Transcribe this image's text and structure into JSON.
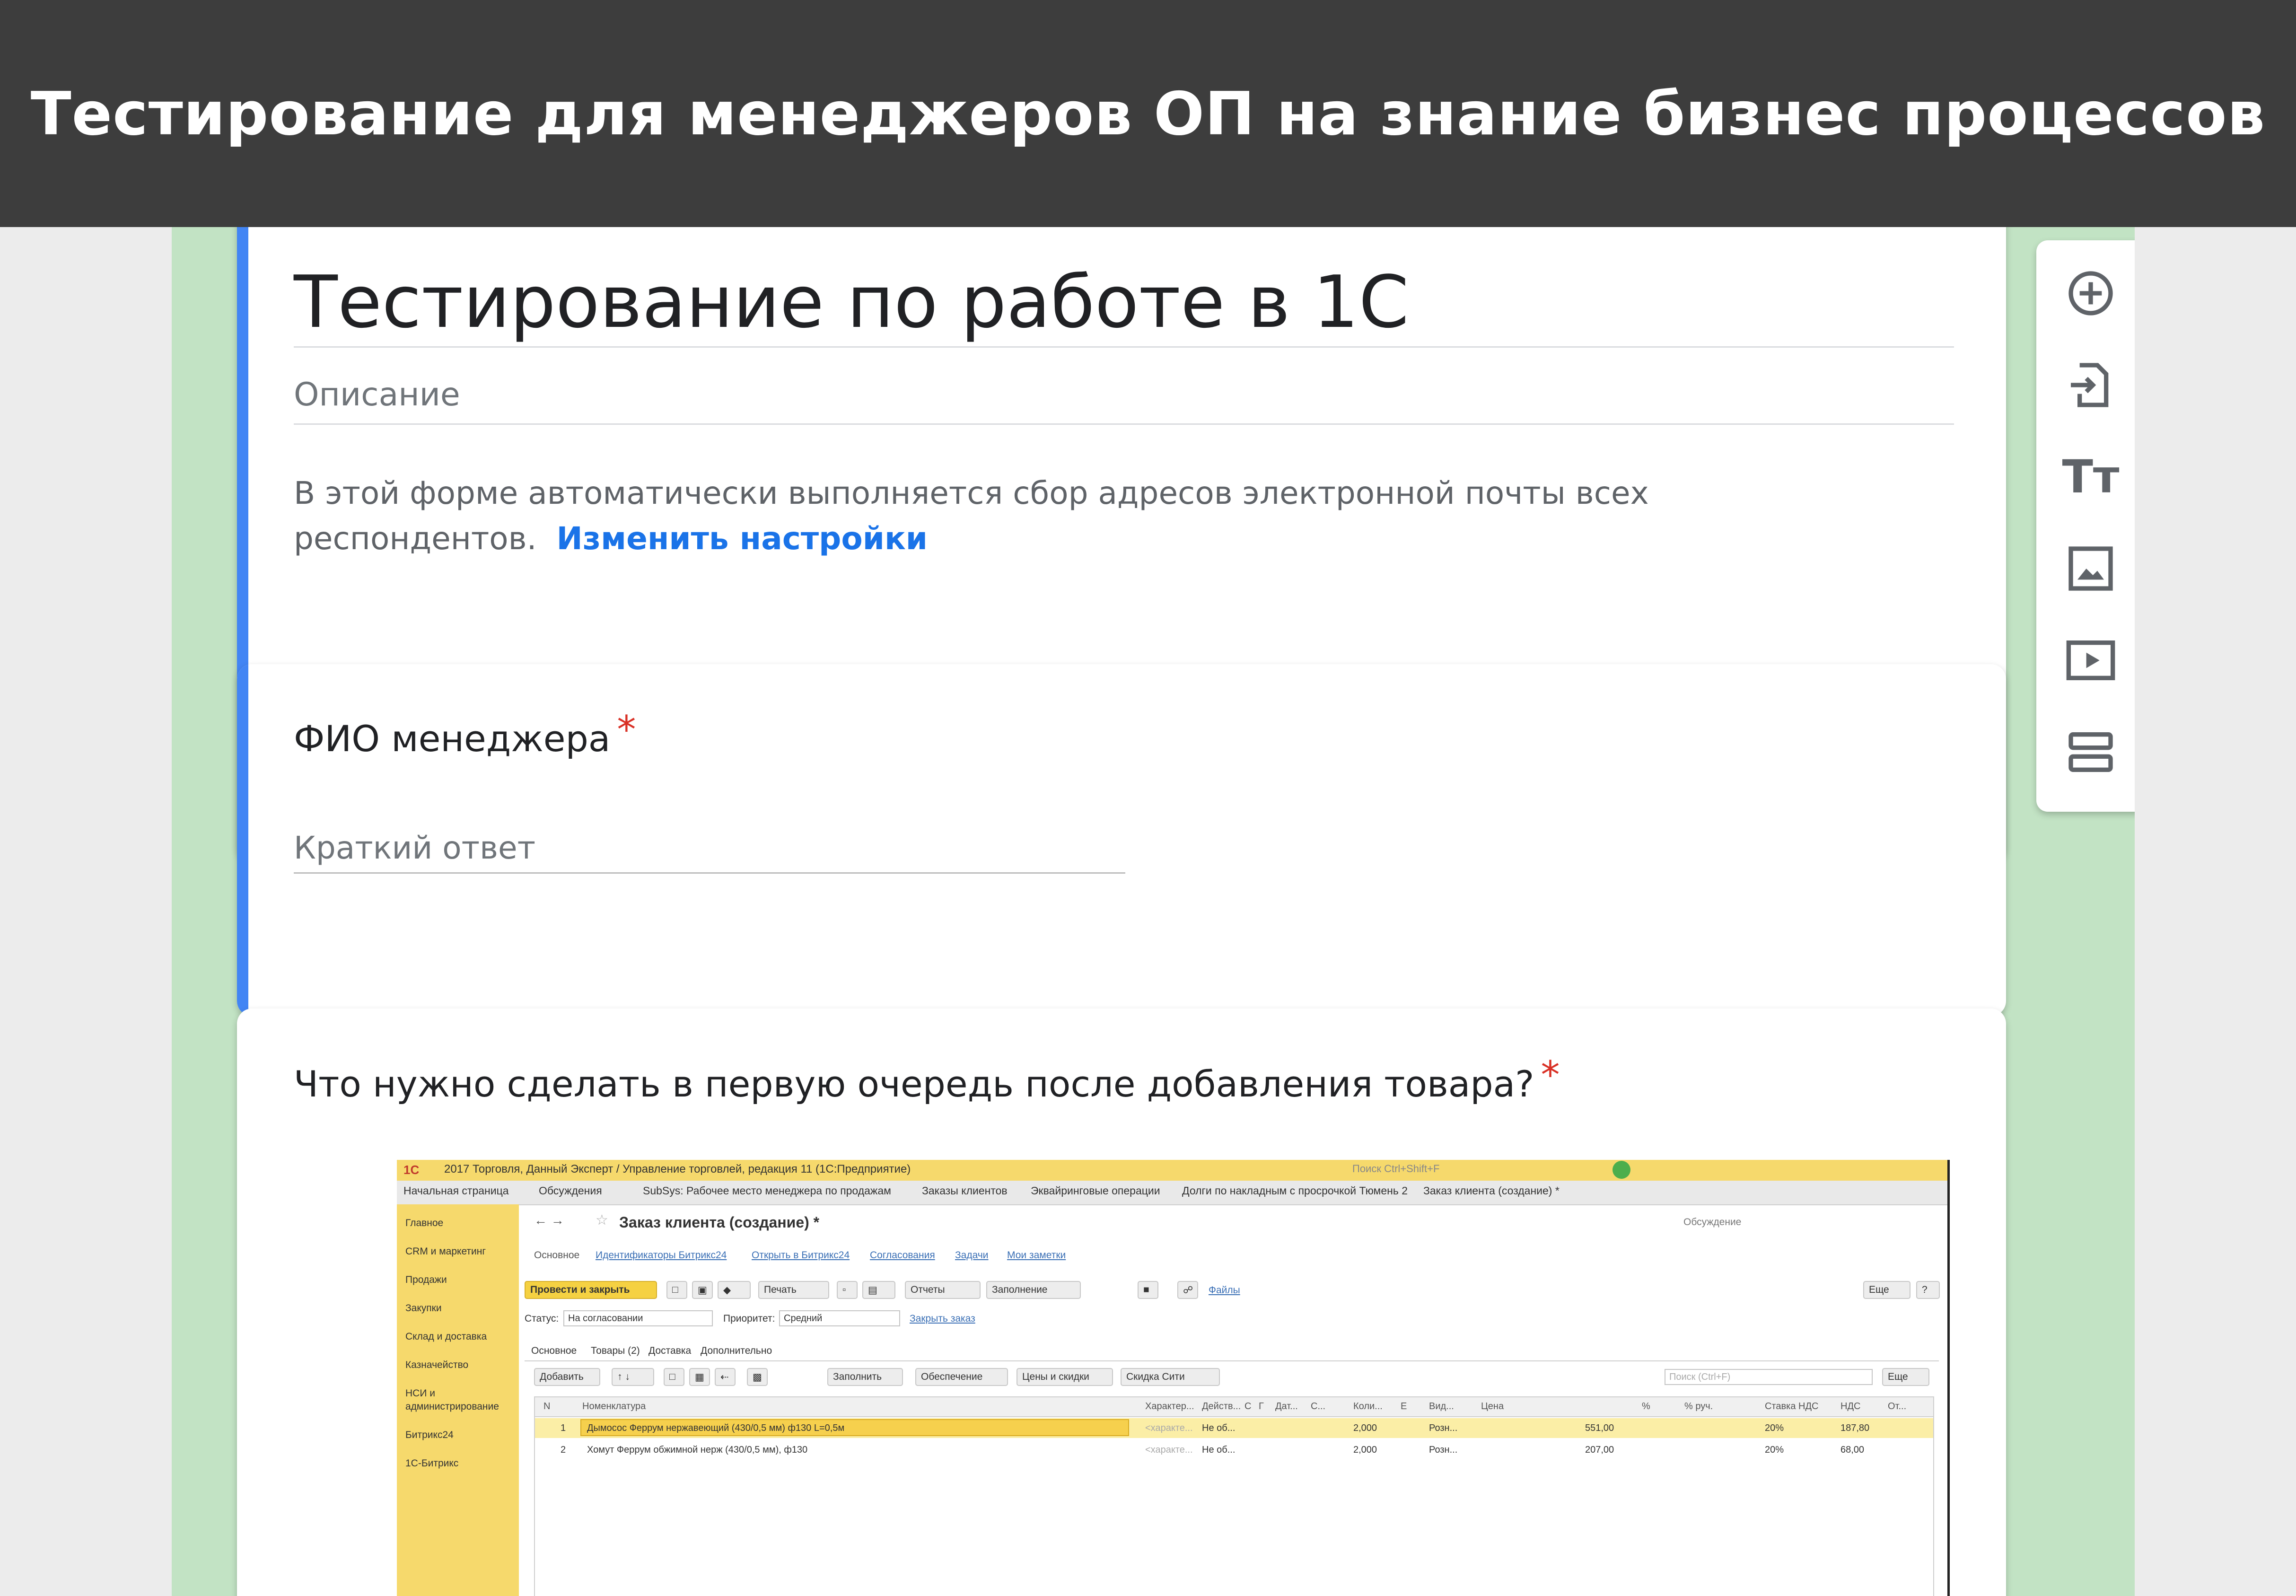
{
  "banner": {
    "title": "Тестирование для менеджеров ОП на знание бизнес процессов"
  },
  "form": {
    "title": "Тестирование по работе в 1С",
    "description_placeholder": "Описание",
    "email_notice": "В этой форме автоматически выполняется сбор адресов электронной почты всех респондентов.",
    "settings_link": "Изменить настройки"
  },
  "questions": [
    {
      "title": "ФИО менеджера",
      "required_mark": "*",
      "answer_placeholder": "Краткий ответ"
    },
    {
      "title": "Что нужно сделать в первую очередь после добавления товара?",
      "required_mark": "*"
    }
  ],
  "toolbar": {
    "items": [
      {
        "icon": "add-question-icon"
      },
      {
        "icon": "import-questions-icon"
      },
      {
        "icon": "add-title-icon",
        "label": "Тт"
      },
      {
        "icon": "add-image-icon"
      },
      {
        "icon": "add-video-icon"
      },
      {
        "icon": "add-section-icon"
      }
    ]
  },
  "screenshot_1c": {
    "window_title": "2017 Торговля, Данный Эксперт / Управление торговлей, редакция 11 (1С:Предприятие)",
    "search_placeholder": "Поиск Ctrl+Shift+F",
    "tabs": [
      "Начальная страница",
      "Обсуждения",
      "SubSys: Рабочее место менеджера по продажам",
      "Заказы клиентов",
      "Эквайринговые операции",
      "Долги по накладным с просрочкой Тюмень 2",
      "Заказ клиента (создание) *"
    ],
    "sidebar": [
      "Главное",
      "CRM и маркетинг",
      "Продажи",
      "Закупки",
      "Склад и доставка",
      "Казначейство",
      "НСИ и",
      "администрирование",
      "Битрикс24",
      "1С-Битрикс"
    ],
    "document_title": "Заказ клиента (создание) *",
    "discussion": "Обсуждение",
    "nav_links": [
      "Основное",
      "Идентификаторы Битрикс24",
      "Открыть в Битрикс24",
      "Согласования",
      "Задачи",
      "Мои заметки"
    ],
    "buttons": {
      "post_close": "Провести и закрыть",
      "print": "Печать",
      "reports": "Отчеты",
      "fill": "Заполнение",
      "files": "Файлы",
      "more": "Еще",
      "help": "?",
      "add": "Добавить",
      "fill_in": "Заполнить",
      "provision": "Обеспечение",
      "prices_discounts": "Цены и скидки",
      "discount_card": "Скидка Сити",
      "more2": "Еще"
    },
    "status_label": "Статус:",
    "status_value": "На согласовании",
    "priority_label": "Приоритет:",
    "priority_value": "Средний",
    "close_order": "Закрыть заказ",
    "doc_tabs": [
      "Основное",
      "Товары (2)",
      "Доставка",
      "Дополнительно"
    ],
    "table_search": "Поиск (Ctrl+F)",
    "columns": [
      "N",
      "Номенклатура",
      "Характер...",
      "Действ...",
      "С",
      "Г",
      "Дат...",
      "С...",
      "Коли...",
      "Е",
      "Вид...",
      "Цена",
      "%",
      "% руч.",
      "Ставка НДС",
      "НДС",
      "От..."
    ],
    "rows": [
      {
        "n": "1",
        "item": "Дымосос Феррум нержавеющий (430/0,5 мм) ф130 L=0,5м",
        "char": "<характе...",
        "act": "Не об...",
        "qty": "2,000",
        "unit": "Розн...",
        "price": "551,00",
        "vat_rate": "20%",
        "vat": "187,80"
      },
      {
        "n": "2",
        "item": "Хомут Феррум обжимной нерж (430/0,5 мм), ф130",
        "char": "<характе...",
        "act": "Не об...",
        "qty": "2,000",
        "unit": "Розн...",
        "price": "207,00",
        "vat_rate": "20%",
        "vat": "68,00"
      }
    ]
  }
}
